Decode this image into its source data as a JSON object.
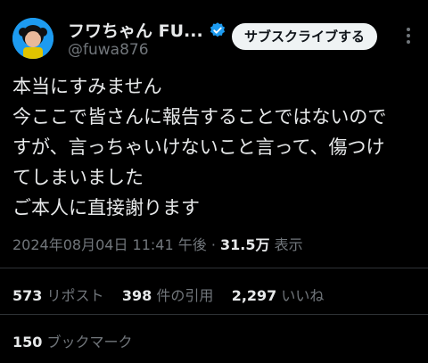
{
  "author": {
    "display_name": "フワちゃん FU...",
    "handle": "@fuwa876",
    "avatar_icon": "profile-photo",
    "verified_icon": "verified-badge-icon",
    "verified_color": "#1d9bf0"
  },
  "header": {
    "subscribe_label": "サブスクライブする",
    "more_icon": "more-vertical-icon"
  },
  "tweet": {
    "lines": [
      "本当にすみません",
      "今ここで皆さんに報告することではないので",
      "すが、言っちゃいけないこと言って、傷つけ",
      "てしまいました",
      "ご本人に直接謝ります"
    ]
  },
  "meta": {
    "timestamp": "2024年08月04日 11:41 午後",
    "separator": " · ",
    "views_count": "31.5万",
    "views_label": " 表示"
  },
  "stats": {
    "reposts_count": "573",
    "reposts_label": " リポスト",
    "quotes_count": "398",
    "quotes_label": " 件の引用",
    "likes_count": "2,297",
    "likes_label": " いいね"
  },
  "bookmarks": {
    "count": "150",
    "label": " ブックマーク"
  }
}
